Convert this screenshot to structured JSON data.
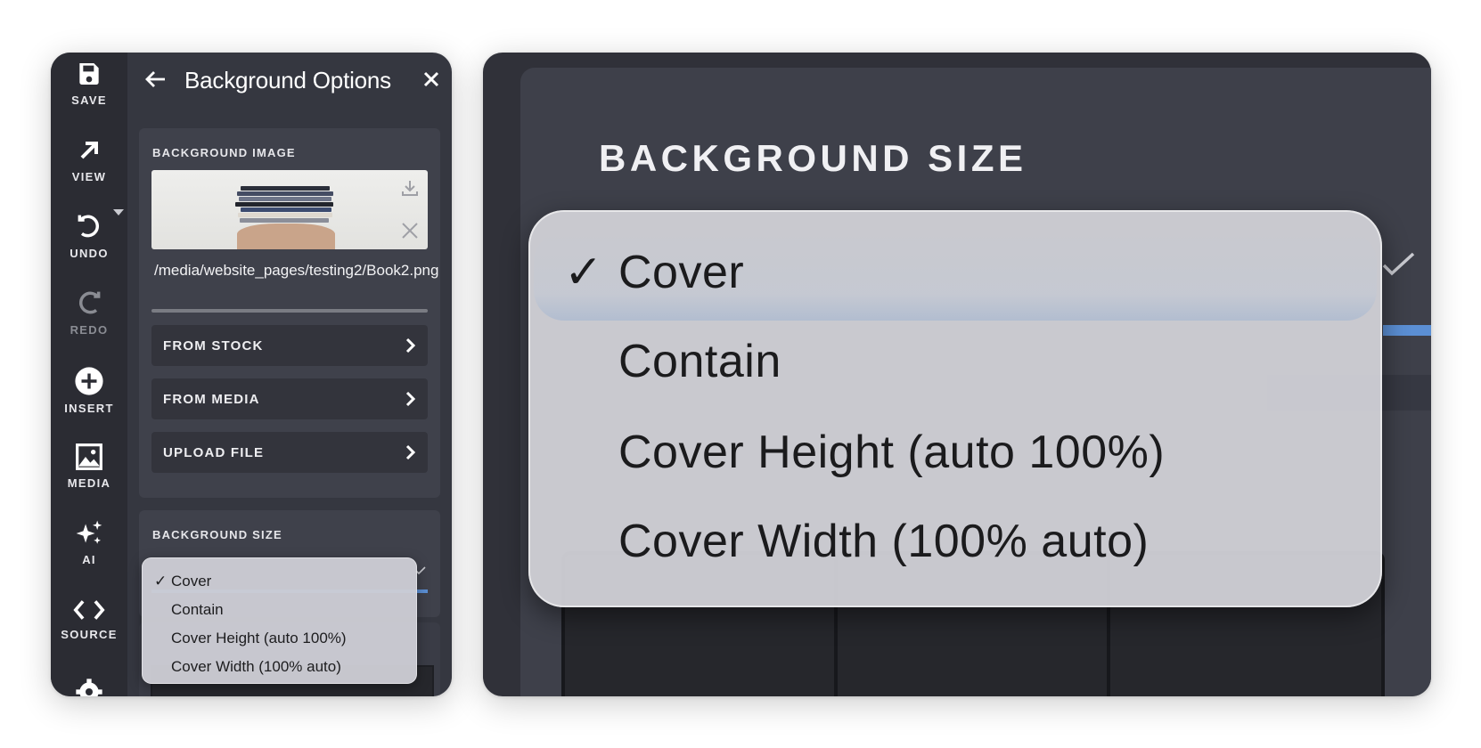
{
  "toolbar": {
    "items": [
      {
        "label": "SAVE",
        "icon": "floppy-disk-icon",
        "enabled": true
      },
      {
        "label": "VIEW",
        "icon": "arrow-up-right-icon",
        "enabled": true
      },
      {
        "label": "UNDO",
        "icon": "undo-icon",
        "enabled": true
      },
      {
        "label": "REDO",
        "icon": "redo-icon",
        "enabled": false
      },
      {
        "label": "INSERT",
        "icon": "plus-circle-icon",
        "enabled": true
      },
      {
        "label": "MEDIA",
        "icon": "image-icon",
        "enabled": true
      },
      {
        "label": "AI",
        "icon": "sparkles-icon",
        "enabled": true
      },
      {
        "label": "SOURCE",
        "icon": "code-icon",
        "enabled": true
      }
    ]
  },
  "panel": {
    "title": "Background Options",
    "background_image": {
      "section_title": "BACKGROUND IMAGE",
      "path": "/media/website_pages/testing2/Book2.png",
      "sources": [
        {
          "label": "FROM STOCK"
        },
        {
          "label": "FROM MEDIA"
        },
        {
          "label": "UPLOAD FILE"
        }
      ]
    },
    "background_size": {
      "section_title": "BACKGROUND SIZE",
      "selected": "Cover",
      "options": [
        {
          "label": "Cover",
          "checked": true
        },
        {
          "label": "Contain",
          "checked": false
        },
        {
          "label": "Cover Height (auto 100%)",
          "checked": false
        },
        {
          "label": "Cover Width (100% auto)",
          "checked": false
        }
      ]
    }
  },
  "zoom": {
    "section_title": "BACKGROUND SIZE",
    "check_glyph": "✓"
  },
  "colors": {
    "sidebar": "#2b2c33",
    "panel": "#353740",
    "section": "#3f414b",
    "accent_blue": "#5b8fd4",
    "dropdown": "#cdcdd4"
  }
}
